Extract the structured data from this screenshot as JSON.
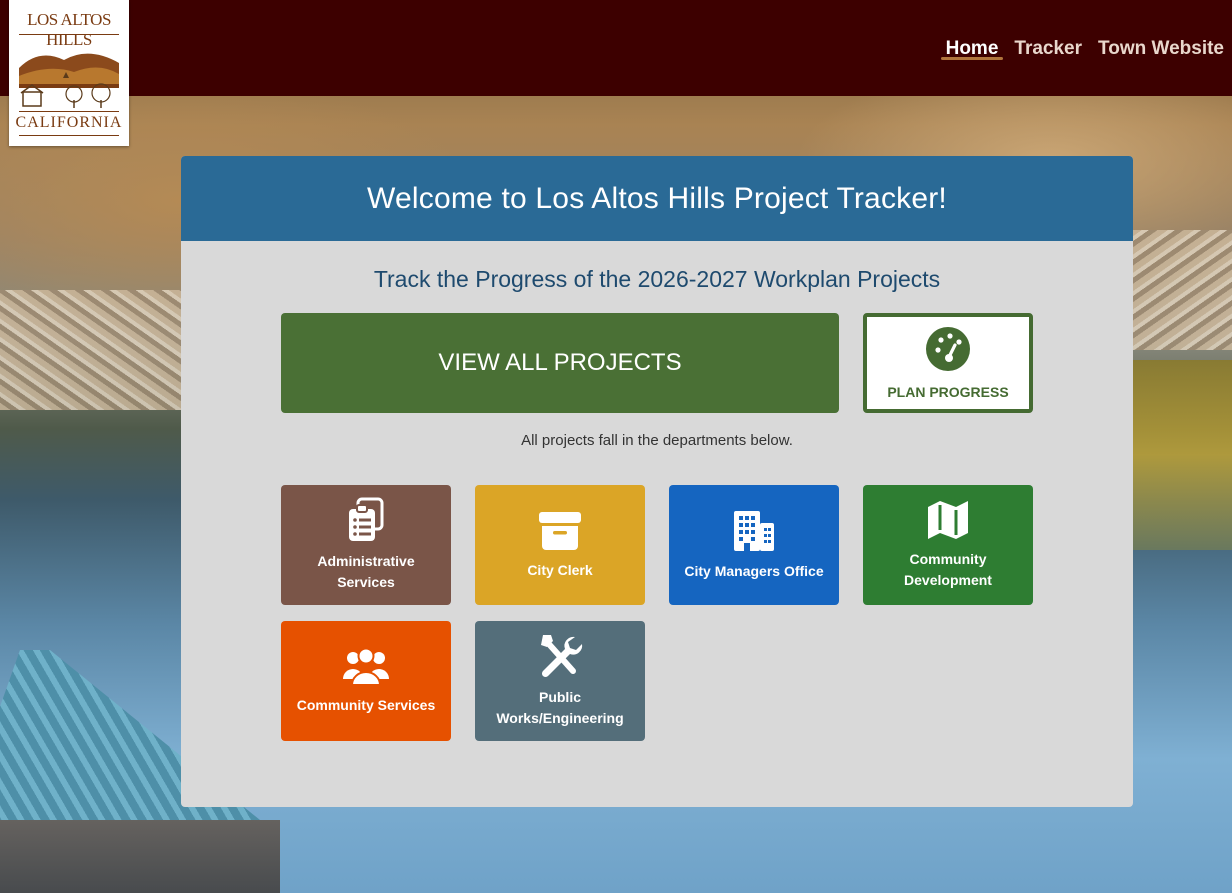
{
  "logo": {
    "top_text": "LOS ALTOS HILLS",
    "bottom_text": "CALIFORNIA"
  },
  "nav": {
    "items": [
      {
        "label": "Home",
        "active": true
      },
      {
        "label": "Tracker",
        "active": false
      },
      {
        "label": "Town Website",
        "active": false
      }
    ]
  },
  "card": {
    "title": "Welcome to Los Altos Hills Project Tracker!",
    "subtitle": "Track the Progress of the 2026-2027 Workplan Projects",
    "view_all_label": "VIEW ALL PROJECTS",
    "plan_progress_label": "PLAN PROGRESS",
    "note": "All projects fall in the departments below."
  },
  "departments": [
    {
      "label": "Administrative Services",
      "color": "#7a5548",
      "icon": "clipboard-list-icon"
    },
    {
      "label": "City Clerk",
      "color": "#dba526",
      "icon": "archive-box-icon"
    },
    {
      "label": "City Managers Office",
      "color": "#1565c0",
      "icon": "building-icon"
    },
    {
      "label": "Community Development",
      "color": "#2e7d32",
      "icon": "map-icon"
    },
    {
      "label": "Community Services",
      "color": "#e65100",
      "icon": "people-group-icon"
    },
    {
      "label": "Public Works/Engineering",
      "color": "#546e7a",
      "icon": "tools-icon"
    }
  ],
  "colors": {
    "header_bg": "#3d0000",
    "card_head_bg": "#2a6a96",
    "primary_green": "#4a7035"
  }
}
